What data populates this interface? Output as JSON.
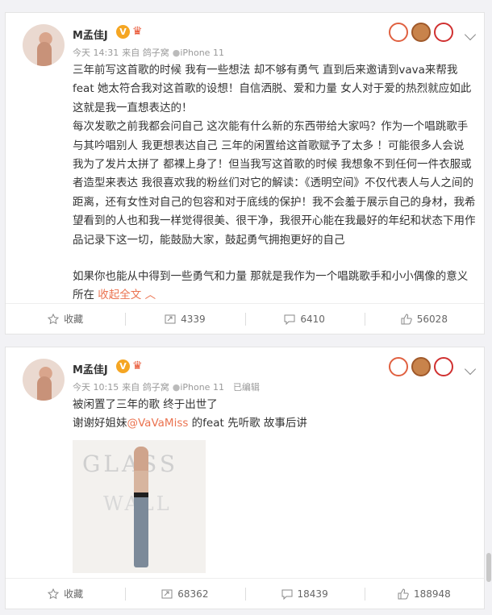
{
  "posts": [
    {
      "username": "M孟佳J",
      "verified_badge": "V",
      "meta_time": "今天 14:31",
      "meta_source": "来自 鸽子窝",
      "meta_device": "iPhone 11",
      "paragraphs": [
        "三年前写这首歌的时候 我有一些想法 却不够有勇气 直到后来邀请到vava来帮我feat 她太符合我对这首歌的设想！自信洒脱、爱和力量 女人对于爱的热烈就应如此 这就是我一直想表达的！",
        "每次发歌之前我都会问自己 这次能有什么新的东西带给大家吗？作为一个唱跳歌手 与其吟唱别人 我更想表达自己 三年的闲置给这首歌赋予了太多 ！可能很多人会说 我为了发片太拼了 都裸上身了！但当我写这首歌的时候 我想象不到任何一件衣服或者造型来表达 我很喜欢我的粉丝们对它的解读：《透明空间》不仅代表人与人之间的距离，还有女性对自己的包容和对于底线的保护！我不会羞于展示自己的身材，我希望看到的人也和我一样觉得很美、很干净，我很开心能在我最好的年纪和状态下用作品记录下这一切，能鼓励大家，鼓起勇气拥抱更好的自己",
        "如果你也能从中得到一些勇气和力量 那就是我作为一个唱跳歌手和小小偶像的意义所在"
      ],
      "collapse_label": "收起全文",
      "actions": {
        "favorite": "收藏",
        "repost": "4339",
        "comment": "6410",
        "like": "56028"
      }
    },
    {
      "username": "M孟佳J",
      "verified_badge": "V",
      "meta_time": "今天 10:15",
      "meta_source": "来自 鸽子窝",
      "meta_device": "iPhone 11",
      "meta_edited": "已编辑",
      "line1": "被闲置了三年的歌 终于出世了",
      "line2_prefix": "谢谢好姐妹",
      "line2_mention": "@VaVaMiss",
      "line2_suffix": " 的feat  先听歌 故事后讲",
      "cover_title_1": "GLASS",
      "cover_title_2": "WALL",
      "actions": {
        "favorite": "收藏",
        "repost": "68362",
        "comment": "18439",
        "like": "188948"
      }
    }
  ],
  "icons": [
    "star-icon",
    "repost-icon",
    "comment-icon",
    "thumb-up-icon",
    "chevron-down-icon",
    "crown-icon",
    "droplet-icon"
  ],
  "colors": {
    "accent": "#eb7350",
    "verified": "#f5a623",
    "background": "#f2f2f5"
  }
}
